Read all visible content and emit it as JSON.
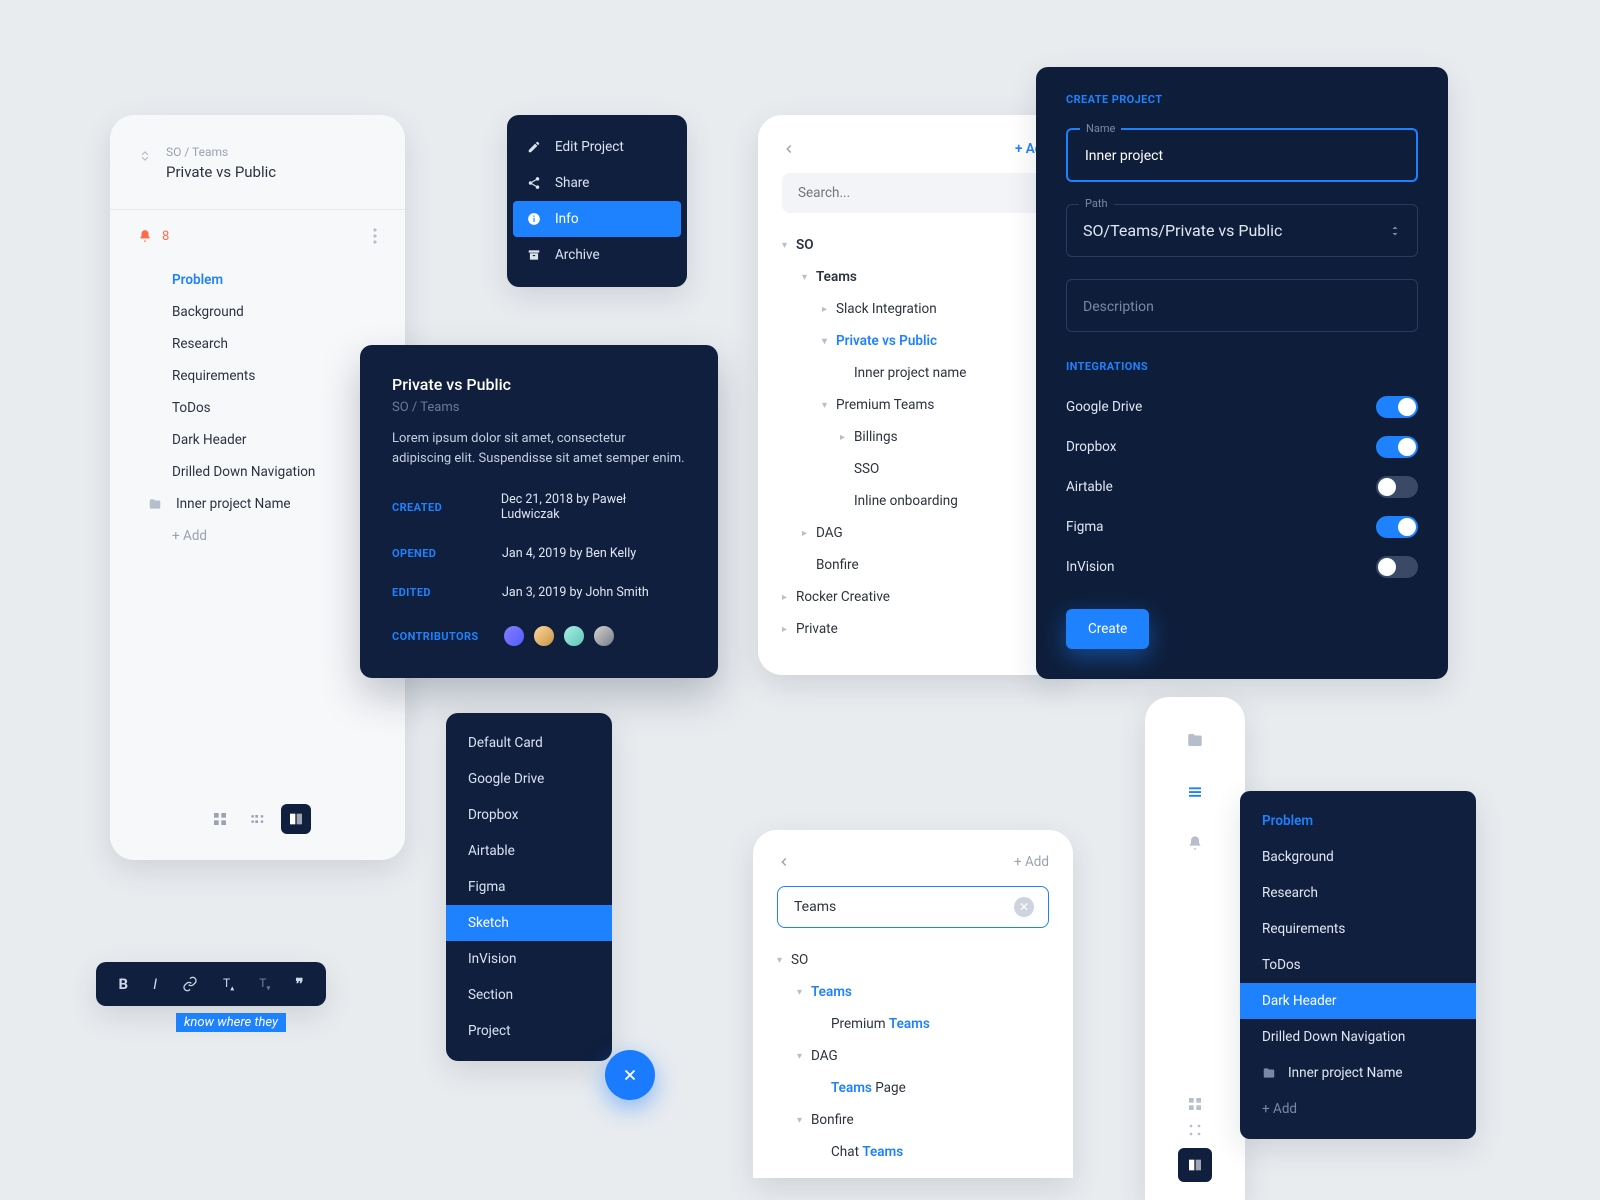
{
  "left_card": {
    "breadcrumb": "SO / Teams",
    "title": "Private vs Public",
    "notif_count": "8",
    "items": [
      "Problem",
      "Background",
      "Research",
      "Requirements",
      "ToDos",
      "Dark Header",
      "Drilled Down Navigation"
    ],
    "folder": "Inner project Name",
    "add": "+ Add"
  },
  "ctx": {
    "edit": "Edit Project",
    "share": "Share",
    "info": "Info",
    "archive": "Archive"
  },
  "info": {
    "title": "Private vs Public",
    "path": "SO / Teams",
    "desc": "Lorem ipsum dolor sit amet, consectetur adipiscing elit. Suspendisse sit amet semper enim.",
    "created_label": "CREATED",
    "created_val": "Dec 21, 2018 by Paweł Ludwiczak",
    "opened_label": "OPENED",
    "opened_val": "Jan 4, 2019 by Ben Kelly",
    "edited_label": "EDITED",
    "edited_val": "Jan 3, 2019 by John Smith",
    "contrib_label": "CONTRIBUTORS"
  },
  "typemenu": [
    "Default Card",
    "Google Drive",
    "Dropbox",
    "Airtable",
    "Figma",
    "Sketch",
    "InVision",
    "Section",
    "Project"
  ],
  "typemenu_active": "Sketch",
  "highlight": "know where they",
  "tree": {
    "add": "+ Add",
    "search_placeholder": "Search...",
    "rows": [
      {
        "label": "SO",
        "depth": 0,
        "caret": "down",
        "bold": true
      },
      {
        "label": "Teams",
        "depth": 1,
        "caret": "down",
        "bold": true
      },
      {
        "label": "Slack Integration",
        "depth": 2,
        "caret": "right"
      },
      {
        "label": "Private vs Public",
        "depth": 2,
        "caret": "down",
        "blue": true
      },
      {
        "label": "Inner project name",
        "depth": 3
      },
      {
        "label": "Premium Teams",
        "depth": 2,
        "caret": "down"
      },
      {
        "label": "Billings",
        "depth": 3,
        "caret": "right"
      },
      {
        "label": "SSO",
        "depth": 3
      },
      {
        "label": "Inline onboarding",
        "depth": 3
      },
      {
        "label": "DAG",
        "depth": 1,
        "caret": "right"
      },
      {
        "label": "Bonfire",
        "depth": 1
      },
      {
        "label": "Rocker Creative",
        "depth": 0,
        "caret": "right"
      },
      {
        "label": "Private",
        "depth": 0,
        "caret": "right"
      }
    ]
  },
  "create": {
    "title": "CREATE PROJECT",
    "name_label": "Name",
    "name_value": "Inner project",
    "path_label": "Path",
    "path_value": "SO/Teams/Private vs Public",
    "desc_placeholder": "Description",
    "integr_title": "INTEGRATIONS",
    "integrations": [
      {
        "name": "Google Drive",
        "on": true
      },
      {
        "name": "Dropbox",
        "on": true
      },
      {
        "name": "Airtable",
        "on": false
      },
      {
        "name": "Figma",
        "on": true
      },
      {
        "name": "InVision",
        "on": false
      }
    ],
    "button": "Create"
  },
  "tree2": {
    "add": "+ Add",
    "search_value": "Teams",
    "rows": [
      {
        "pre": "",
        "label": "SO",
        "depth": 0,
        "caret": "down"
      },
      {
        "hl": "Teams",
        "depth": 1,
        "caret": "down"
      },
      {
        "pre": "Premium ",
        "hl": "Teams",
        "depth": 2
      },
      {
        "pre": "",
        "label": "DAG",
        "depth": 1,
        "caret": "down"
      },
      {
        "hl": "Teams",
        "post": " Page",
        "depth": 2
      },
      {
        "pre": "",
        "label": "Bonfire",
        "depth": 1,
        "caret": "down"
      },
      {
        "pre": "Chat ",
        "hl": "Teams",
        "depth": 2
      }
    ]
  },
  "popup": {
    "items": [
      "Problem",
      "Background",
      "Research",
      "Requirements",
      "ToDos",
      "Dark Header",
      "Drilled Down Navigation"
    ],
    "active": "Dark Header",
    "blue": "Problem",
    "folder": "Inner project Name",
    "add": "+ Add"
  }
}
